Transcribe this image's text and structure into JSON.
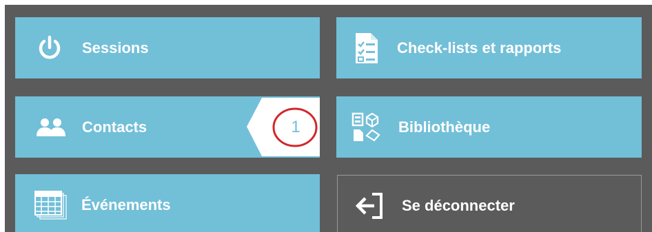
{
  "tiles": {
    "sessions": {
      "label": "Sessions",
      "icon": "power-icon"
    },
    "checklists": {
      "label": "Check-lists et rapports",
      "icon": "checklist-document-icon"
    },
    "contacts": {
      "label": "Contacts",
      "icon": "contacts-icon",
      "badge_count": "1"
    },
    "library": {
      "label": "Bibliothèque",
      "icon": "library-icon"
    },
    "events": {
      "label": "Événements",
      "icon": "calendar-icon"
    },
    "logout": {
      "label": "Se déconnecter",
      "icon": "logout-icon"
    }
  },
  "colors": {
    "background": "#5b5b5b",
    "tile": "#72bfd8",
    "text": "#ffffff",
    "annotation_circle": "#d0282a"
  }
}
